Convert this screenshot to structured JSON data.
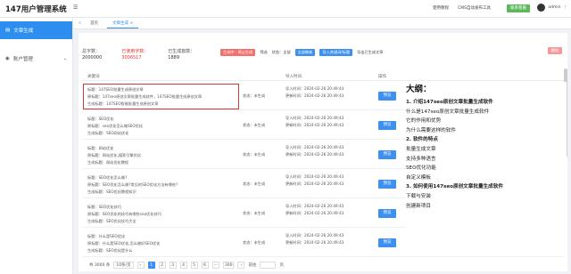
{
  "app": {
    "title": "147用户管理系统"
  },
  "topbar": {
    "links": [
      "使用教程",
      "CMS自动发布工具"
    ],
    "action_button": "联系客服",
    "user": "admin"
  },
  "sidebar": {
    "items": [
      {
        "label": "文章生成",
        "active": true
      },
      {
        "label": "账户管理",
        "active": false
      }
    ]
  },
  "tabs": [
    {
      "label": "首页",
      "active": false
    },
    {
      "label": "文章生成 ×",
      "active": true
    }
  ],
  "stats": [
    {
      "label": "总字数：",
      "value": "2000000"
    },
    {
      "label": "已使用字数：",
      "value": "3006517"
    },
    {
      "label": "已生成篇数：",
      "value": "1889"
    }
  ],
  "actions": {
    "generate": "生成中 · 停止生成",
    "filter_label": "筛选",
    "status_label": "状态：全部",
    "refresh": "全部刷新",
    "export": "导入关键词/标题",
    "export_all": "导出已生成文章",
    "delete": "删除"
  },
  "table": {
    "headers": [
      "关键词",
      "导入时间",
      "操作"
    ],
    "rows": [
      {
        "titles": [
          "标题：147SEO批量生成原创文章",
          "原标题：147seo原创文章批量生成软件，147SEO批量生成原创文章",
          "生成标题：147SEO智能批量生成原创文章"
        ],
        "status": "状态：未生成",
        "times": [
          "导入时间：2024-02-26 20:49:43",
          "更新时间：2024-02-26 20:49:43"
        ],
        "preview": "预览"
      },
      {
        "titles": [
          "标题：SEO优化",
          "原标题：seo优化怎么做SEO优化",
          "生成标题：SEO网站优化"
        ],
        "status": "状态：未生成",
        "times": [
          "导入时间：2024-02-26 20:49:43",
          "更新时间：2024-02-26 20:49:43"
        ],
        "preview": "预览"
      },
      {
        "titles": [
          "标题：网站优化",
          "原标题：网站优化,搜索引擎优化",
          "生成标题：网站优化教程"
        ],
        "status": "状态：未生成",
        "times": [
          "导入时间：2024-02-26 20:49:43",
          "更新时间：2024-02-26 20:49:43"
        ],
        "preview": "预览"
      },
      {
        "titles": [
          "标题：SEO优化怎么做?",
          "原标题：SEO优化怎么做?常见的SEO优化方法有哪些?",
          "生成标题：SEO优化教程知识"
        ],
        "status": "状态：未生成",
        "times": [
          "导入时间：2024-02-26 20:49:43",
          "更新时间：2024-02-26 20:49:43"
        ],
        "preview": "预览"
      },
      {
        "titles": [
          "标题：SEO优化技巧",
          "原标题：SEO优化的技巧有哪些seo优化技巧",
          "生成标题：SEO优化技巧大全"
        ],
        "status": "状态：未生成",
        "times": [
          "导入时间：2024-02-26 20:49:43",
          "更新时间：2024-02-26 20:49:43"
        ],
        "preview": "预览"
      },
      {
        "titles": [
          "标题：什么是SEO优化",
          "原标题：什么是SEO优化,怎么做好SEO优化",
          "生成标题：SEO优化是什么"
        ],
        "status": "状态：未生成",
        "times": [
          "导入时间：2024-02-26 20:49:43",
          "更新时间：2024-02-26 20:49:43"
        ],
        "preview": "预览"
      }
    ]
  },
  "outline": {
    "heading": "大纲：",
    "items": [
      {
        "text": "1. 介绍147seo原创文章批量生成软件",
        "bold": true
      },
      {
        "text": "什么是147seo原创文章批量生成软件",
        "bold": false
      },
      {
        "text": "它的作用和优势",
        "bold": false
      },
      {
        "text": "为什么需要这样的软件",
        "bold": false
      },
      {
        "text": "2. 软件的特点",
        "bold": true
      },
      {
        "text": "批量生成文章",
        "bold": false
      },
      {
        "text": "支持多种语言",
        "bold": false
      },
      {
        "text": "SEO优化功能",
        "bold": false
      },
      {
        "text": "自定义模板",
        "bold": false
      },
      {
        "text": "3. 如何使用147seo原创文章批量生成软件",
        "bold": true
      },
      {
        "text": "下载与安装",
        "bold": false
      },
      {
        "text": "创建新项目",
        "bold": false
      }
    ]
  },
  "pagination": {
    "total": "共 3000 条",
    "page_size": "10条/页",
    "prev": "‹",
    "pages": [
      "1",
      "2",
      "3",
      "4",
      "5",
      "6",
      "···",
      "300"
    ],
    "next": "›",
    "goto_label": "前往",
    "page_suffix": "页"
  }
}
